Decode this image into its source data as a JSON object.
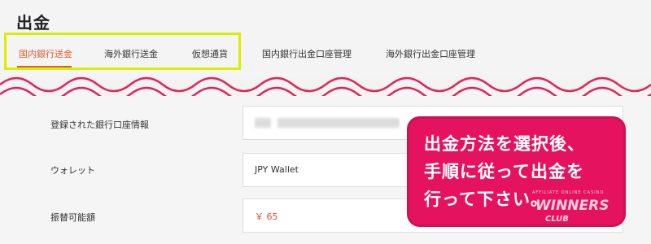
{
  "page": {
    "title": "出金"
  },
  "tabs": [
    {
      "label": "国内銀行送金",
      "active": true
    },
    {
      "label": "海外銀行送金",
      "active": false
    },
    {
      "label": "仮想通貨",
      "active": false
    },
    {
      "label": "国内銀行出金口座管理",
      "active": false
    },
    {
      "label": "海外銀行出金口座管理",
      "active": false
    }
  ],
  "form": {
    "rows": [
      {
        "label": "登録された銀行口座情報",
        "value": ""
      },
      {
        "label": "ウォレット",
        "value": "JPY Wallet"
      },
      {
        "label": "振替可能額",
        "value": "￥ 65"
      }
    ]
  },
  "callout": {
    "lines": [
      "出金方法を選択後、",
      "手順に従って出金を",
      "行って下さい。"
    ]
  },
  "logo": {
    "small": "AFFILIATE ONLINE CASINO",
    "main": "WINNERS",
    "sub": "CLUB"
  },
  "colors": {
    "accent": "#e35b2b",
    "highlight": "#d7f000",
    "callout": "#e5135f",
    "wave": "#e0245e"
  }
}
